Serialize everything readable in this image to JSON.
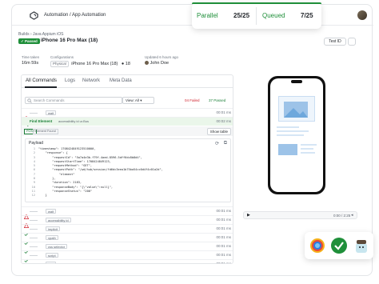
{
  "topbar": {
    "breadcrumb": "Automation / App Automation"
  },
  "build": {
    "breadcrumb": "Builds  ›  Java Appium iOS",
    "status": "✓ Passed",
    "title": "iPhone 16 Pro Max (18)",
    "test_id_label": "Test ID"
  },
  "meta": {
    "time_taken_label": "Time taken",
    "time_taken": "16m 59s",
    "configs_label": "Configurations",
    "config_chip": "Physical",
    "device": "iPhone 16 Pro Max (18)",
    "count": "18",
    "updated_label": "Updated 6 hours ago",
    "user": "John Doe"
  },
  "tabs": [
    "All Commands",
    "Logs",
    "Network",
    "Meta Data"
  ],
  "filters": {
    "search_placeholder": "Search Commands",
    "view": "View: All",
    "failed": "04 Failed",
    "passed": "37 Passed"
  },
  "rows_top": [
    {
      "status": "fail",
      "cmd": "wait",
      "time": "00:01 ms"
    },
    {
      "status": "ok",
      "cmd": "Find Element",
      "extra": "accessibility id   ur.Bus",
      "time": "00:02 ms"
    }
  ],
  "subrow": {
    "tags": [
      "POST",
      "Element Found"
    ],
    "show_table": "Show table"
  },
  "payload": {
    "title": "Payload",
    "lines": [
      "\"timestamp\": 1708424849123510000,",
      "    \"response\": {",
      "        \"requestId\": \"5a7a4e3b-f79f-4aed-8596-5dff6dc8b8d4\",",
      "        \"requestStartTime\": 1708424849123,",
      "        \"requestMethod\": \"GET\",",
      "        \"requestPath\": \"/wd/hub/session/fd6dc3eea1b75ba54cc0d4f4c01a2d\",",
      "            \"element\"",
      "        },",
      "        \"duration\": 2183,",
      "        \"responseBody\": \"{\\\"value\\\":null}\",",
      "        \"responseStatus\": \"200\"",
      "    }"
    ]
  },
  "rows_bottom": [
    {
      "status": "fail",
      "cmd": "wait",
      "time": "00:01 ms"
    },
    {
      "status": "fail",
      "cmd": "accessibility id",
      "time": "00:01 ms"
    },
    {
      "status": "ok",
      "cmd": "implicit",
      "time": "00:01 ms"
    },
    {
      "status": "ok",
      "cmd": "xpath",
      "time": "00:01 ms"
    },
    {
      "status": "ok",
      "cmd": "css selector",
      "time": "00:01 ms"
    },
    {
      "status": "ok",
      "cmd": "script",
      "time": "00:01 ms"
    },
    {
      "status": "ok",
      "cmd": "wait",
      "time": "00:01 ms"
    }
  ],
  "player": {
    "time": "0:00  /  2:25"
  },
  "summary": {
    "parallel_label": "Parallel",
    "parallel_value": "25/25",
    "queued_label": "Queued",
    "queued_value": "7/25"
  },
  "colors": {
    "accent": "#1f8f3a",
    "fail": "#d1242f",
    "highlight": "#eaf6ea"
  }
}
